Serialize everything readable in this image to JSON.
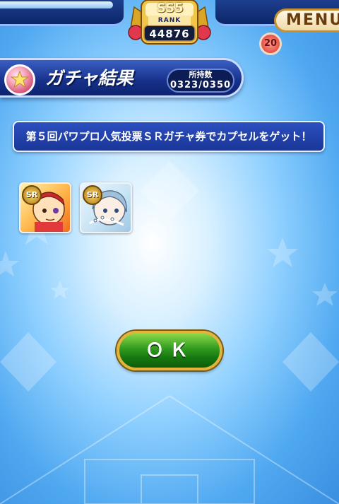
{
  "rank": {
    "tier": "SS5",
    "label": "RANK",
    "value": "44876"
  },
  "menu": {
    "label": "MENU",
    "badge": "20"
  },
  "header": {
    "title": "ガチャ結果",
    "owned_label": "所持数",
    "owned_value": "0323/0350",
    "icon": "capsule-icon"
  },
  "message": "第５回パワプロ人気投票ＳＲガチャ券でカプセルをゲット！",
  "rewards": [
    {
      "rarity": "SR",
      "icon": "character-card-icon"
    },
    {
      "rarity": "SR",
      "icon": "character-card-icon"
    }
  ],
  "ok_button": {
    "label": "ＯＫ"
  },
  "colors": {
    "header_bg": "#16308a",
    "banner_bg": "#1a3698",
    "ok_green": "#2f9a1e",
    "ok_border": "#e2b43c",
    "menu_border": "#c58f33"
  }
}
